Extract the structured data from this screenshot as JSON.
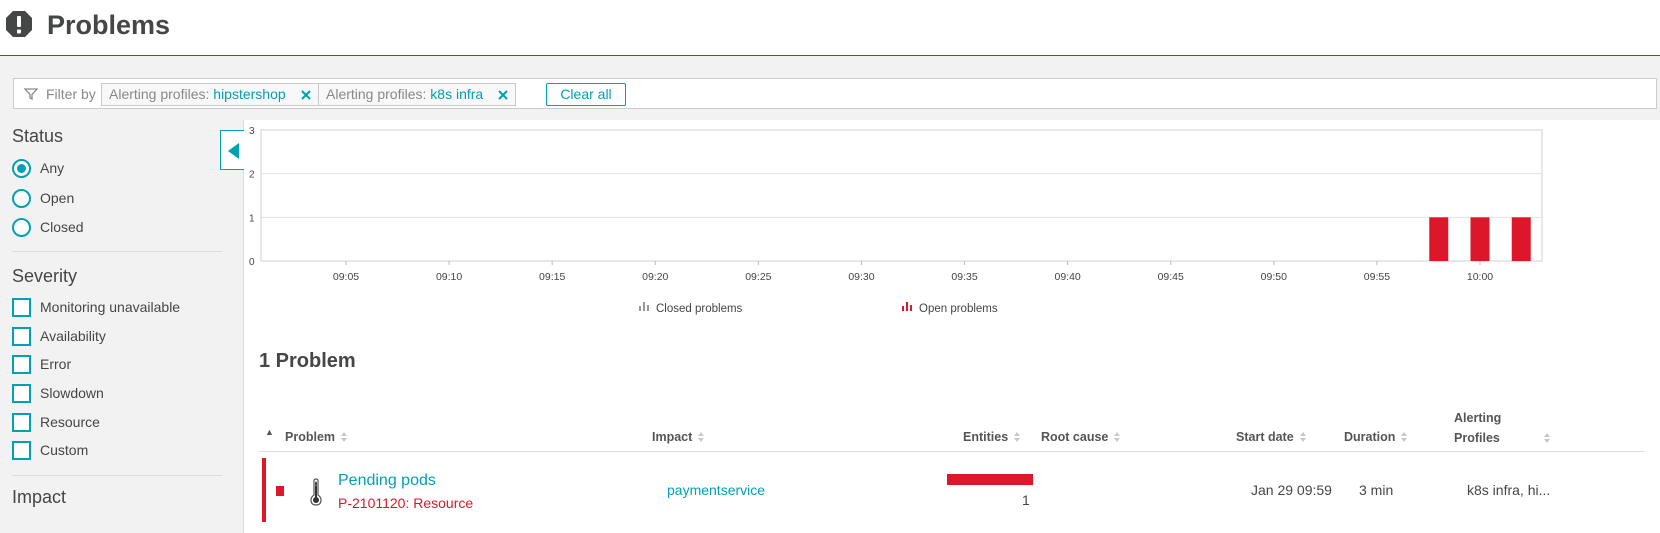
{
  "header": {
    "title": "Problems"
  },
  "filter": {
    "label": "Filter by",
    "chips": [
      {
        "key": "Alerting profiles:",
        "value": "hipstershop"
      },
      {
        "key": "Alerting profiles:",
        "value": "k8s infra"
      }
    ],
    "clear_label": "Clear all"
  },
  "sidebar": {
    "status_title": "Status",
    "status_options": [
      {
        "label": "Any",
        "checked": true
      },
      {
        "label": "Open",
        "checked": false
      },
      {
        "label": "Closed",
        "checked": false
      }
    ],
    "severity_title": "Severity",
    "severity_options": [
      {
        "label": "Monitoring unavailable"
      },
      {
        "label": "Availability"
      },
      {
        "label": "Error"
      },
      {
        "label": "Slowdown"
      },
      {
        "label": "Resource"
      },
      {
        "label": "Custom"
      }
    ],
    "impact_title": "Impact"
  },
  "chart_data": {
    "type": "bar",
    "y_ticks": [
      "3",
      "2",
      "1",
      "0"
    ],
    "ylim": [
      0,
      3
    ],
    "x_ticks": [
      "09:05",
      "09:10",
      "09:15",
      "09:20",
      "09:25",
      "09:30",
      "09:35",
      "09:40",
      "09:45",
      "09:50",
      "09:55",
      "10:00"
    ],
    "series": [
      {
        "name": "Closed problems",
        "color": "#999999",
        "points": []
      },
      {
        "name": "Open problems",
        "color": "#dc172a",
        "points": [
          {
            "x": "09:58",
            "y": 1
          },
          {
            "x": "10:00",
            "y": 1
          },
          {
            "x": "10:02",
            "y": 1
          }
        ]
      }
    ],
    "grid": true,
    "legend_position": "bottom-center"
  },
  "colors": {
    "accent": "#00a1b2",
    "error": "#dc172a",
    "header_line": "#dc172a"
  },
  "main": {
    "problem_count": "1 Problem",
    "columns": {
      "problem": "Problem",
      "impact": "Impact",
      "entities": "Entities",
      "root_cause": "Root cause",
      "start_date": "Start date",
      "duration": "Duration",
      "alerting_profiles_1": "Alerting",
      "alerting_profiles_2": "Profiles"
    },
    "rows": [
      {
        "name": "Pending pods",
        "id": "P-2101120: Resource",
        "impact": "paymentservice",
        "entities": "1",
        "root_cause": "",
        "start_date": "Jan 29 09:59",
        "duration": "3 min",
        "profiles": "k8s infra, hi...",
        "icon": "thermometer-icon"
      }
    ]
  }
}
